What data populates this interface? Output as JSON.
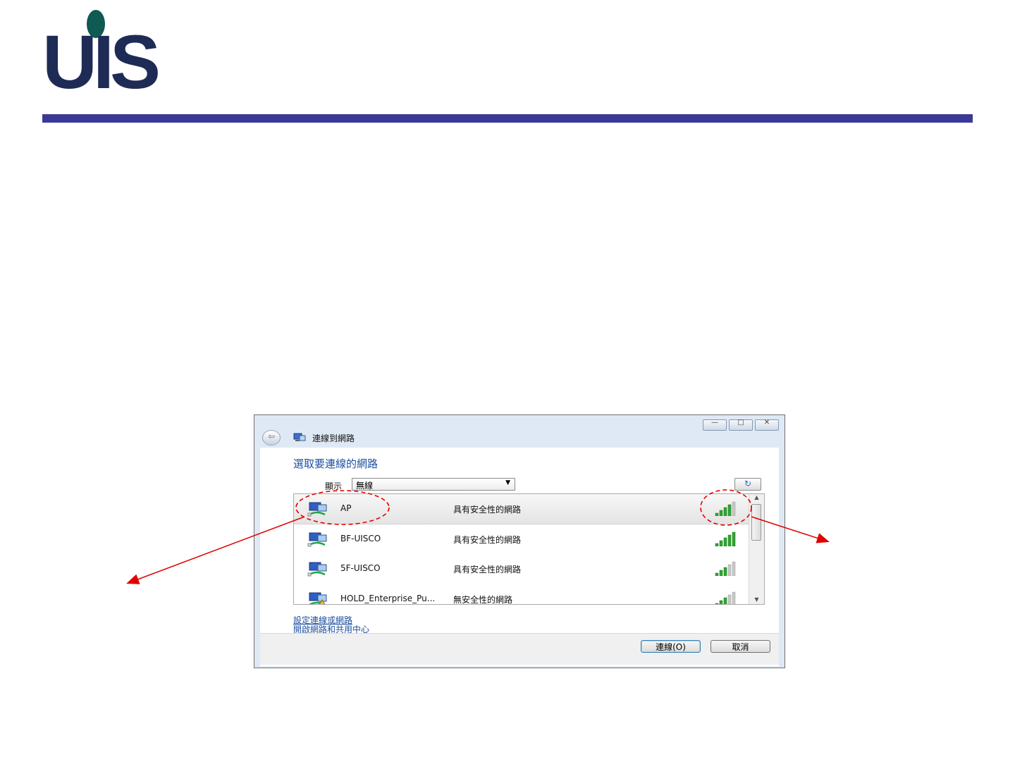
{
  "logo": {
    "text": "UIS"
  },
  "window": {
    "title": "連線到網路",
    "controls": {
      "minimize": "—",
      "maximize": "□",
      "close": "✕"
    },
    "heading": "選取要連線的網路",
    "show_label": "顯示",
    "filter": {
      "selected": "無線"
    },
    "refresh_icon": "↻"
  },
  "networks": [
    {
      "name": "AP",
      "security": "具有安全性的網路",
      "signal_bars": 4,
      "selected": true,
      "warning": false
    },
    {
      "name": "BF-UISCO",
      "security": "具有安全性的網路",
      "signal_bars": 5,
      "selected": false,
      "warning": false
    },
    {
      "name": "5F-UISCO",
      "security": "具有安全性的網路",
      "signal_bars": 3,
      "selected": false,
      "warning": false
    },
    {
      "name": "HOLD_Enterprise_Pu...",
      "security": "無安全性的網路",
      "signal_bars": 3,
      "selected": false,
      "warning": true
    }
  ],
  "links": {
    "setup": "設定連線或網路",
    "network_center": "開啟網路和共用中心"
  },
  "buttons": {
    "connect": "連線(O)",
    "cancel": "取消"
  },
  "colors": {
    "brand_navy": "#1e2b55",
    "brand_green": "#0f5a52",
    "header_bar": "#3a3a96",
    "annotation": "#e00000",
    "signal_green": "#2fa62f"
  }
}
